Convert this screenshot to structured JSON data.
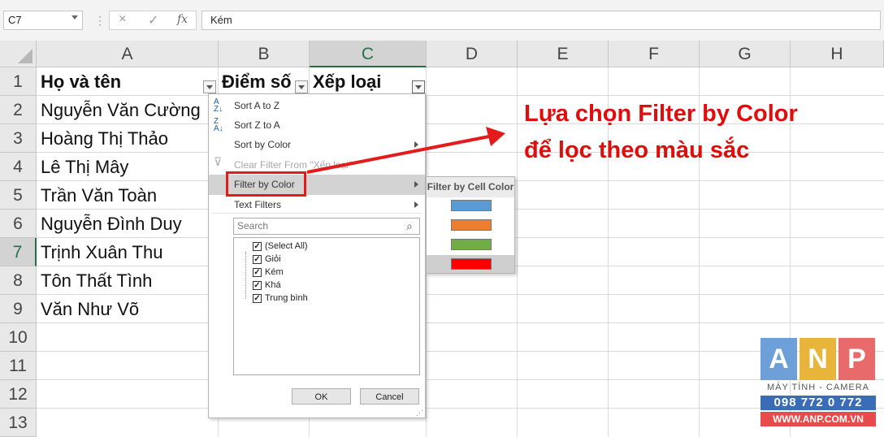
{
  "formula_bar": {
    "name_box": "C7",
    "cancel_icon": "×",
    "enter_icon": "✓",
    "fx_label": "fx",
    "content": "Kém"
  },
  "columns": [
    "A",
    "B",
    "C",
    "D",
    "E",
    "F",
    "G",
    "H"
  ],
  "rows": [
    "1",
    "2",
    "3",
    "4",
    "5",
    "6",
    "7",
    "8",
    "9",
    "10",
    "11",
    "12",
    "13"
  ],
  "table": {
    "headers": [
      "Họ và tên",
      "Điểm số",
      "Xếp loại"
    ],
    "names": [
      "Nguyễn Văn Cường",
      "Hoàng Thị Thảo",
      "Lê Thị Mây",
      "Trần Văn Toàn",
      "Nguyễn Đình Duy",
      "Trịnh Xuân Thu",
      "Tôn Thất Tình",
      "Văn Như Võ"
    ]
  },
  "filter_menu": {
    "items": [
      {
        "label": "Sort A to Z",
        "icon": "sort-a-z-icon"
      },
      {
        "label": "Sort Z to A",
        "icon": "sort-z-a-icon"
      },
      {
        "label": "Sort by Color"
      },
      {
        "label": "Clear Filter From \"Xếp loại\"",
        "disabled": true,
        "icon": "clear-filter-icon"
      },
      {
        "label": "Filter by Color",
        "highlighted": true
      },
      {
        "label": "Text Filters"
      }
    ],
    "search_placeholder": "Search",
    "checklist": [
      {
        "label": "(Select All)",
        "checked": true
      },
      {
        "label": "Giỏi",
        "checked": true
      },
      {
        "label": "Kém",
        "checked": true
      },
      {
        "label": "Khá",
        "checked": true
      },
      {
        "label": "Trung bình",
        "checked": true
      }
    ],
    "ok_label": "OK",
    "cancel_label": "Cancel"
  },
  "color_submenu": {
    "title": "Filter by Cell Color",
    "colors": [
      "#5b9bd5",
      "#ed7d31",
      "#70ad47",
      "#ff0000"
    ],
    "selected_index": 3
  },
  "annotation": {
    "line1": "Lựa chọn Filter by Color",
    "line2": "để lọc theo màu sắc",
    "color": "#e00d0d"
  },
  "logo": {
    "letters": [
      "A",
      "N",
      "P"
    ],
    "letter_colors": [
      "#6d9fd8",
      "#e8b43a",
      "#e86a6a"
    ],
    "subtitle": "MÁY TÍNH - CAMERA",
    "phone": "098 772 0 772",
    "website": "WWW.ANP.COM.VN"
  }
}
